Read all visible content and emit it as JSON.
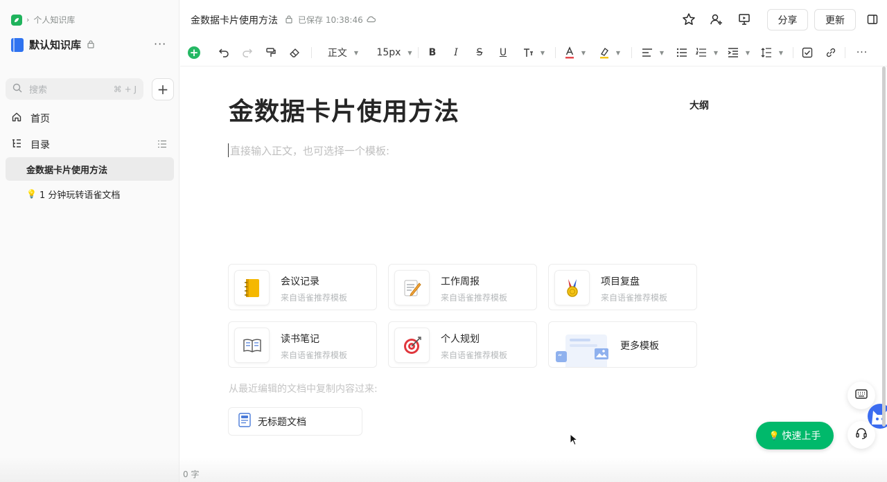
{
  "sidebar": {
    "breadcrumb": "个人知识库",
    "kb_title": "默认知识库",
    "more": "···",
    "search_placeholder": "搜索",
    "search_shortcut": "⌘ + J",
    "add": "+",
    "nav": [
      {
        "label": "首页"
      },
      {
        "label": "目录"
      }
    ],
    "docs": [
      {
        "label": "金数据卡片使用方法"
      },
      {
        "label": "1 分钟玩转语雀文档"
      }
    ]
  },
  "header": {
    "doc_title": "金数据卡片使用方法",
    "saved": "已保存 10:38:46",
    "share": "分享",
    "update": "更新"
  },
  "toolbar": {
    "style": "正文",
    "font_size": "15px"
  },
  "editor": {
    "title": "金数据卡片使用方法",
    "outline": "大纲",
    "placeholder": "直接输入正文，也可选择一个模板:",
    "templates": [
      {
        "name": "会议记录",
        "sub": "来自语雀推荐模板",
        "icon": "notebook-icon"
      },
      {
        "name": "工作周报",
        "sub": "来自语雀推荐模板",
        "icon": "memo-icon"
      },
      {
        "name": "项目复盘",
        "sub": "来自语雀推荐模板",
        "icon": "medal-icon"
      },
      {
        "name": "读书笔记",
        "sub": "来自语雀推荐模板",
        "icon": "open-book-icon"
      },
      {
        "name": "个人规划",
        "sub": "来自语雀推荐模板",
        "icon": "target-icon"
      },
      {
        "name": "更多模板"
      }
    ],
    "recent_hint": "从最近编辑的文档中复制内容过来:",
    "recent_doc": "无标题文档"
  },
  "floating": {
    "quick_start": "快速上手"
  },
  "status": {
    "word_count": "0 字"
  },
  "colors": {
    "brand_green": "#00b96b",
    "sidebar_bg": "#fafafa",
    "active_item": "#ebebeb",
    "accent_blue": "#2f73f0"
  }
}
